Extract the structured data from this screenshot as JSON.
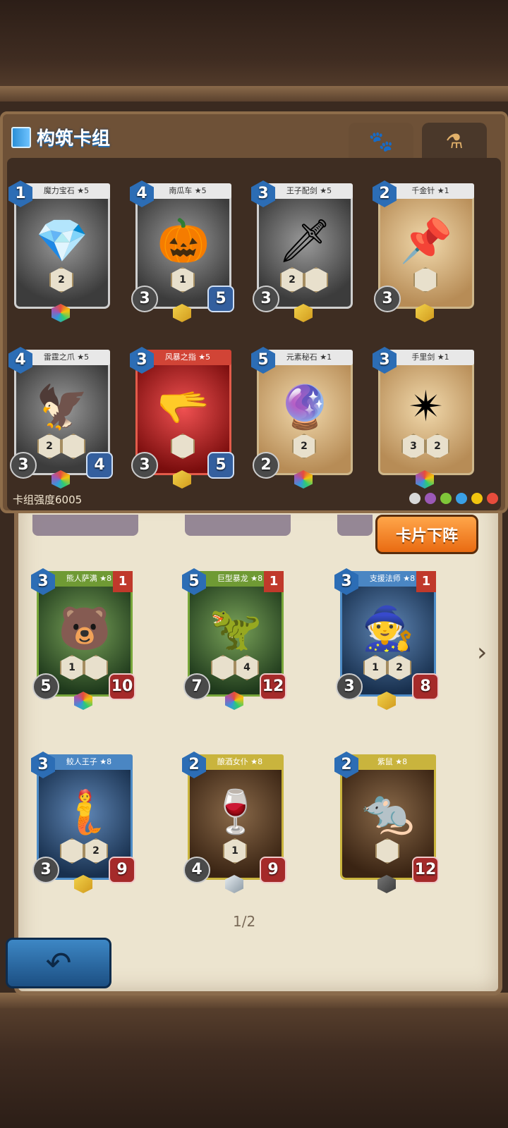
{
  "header": {
    "title": "构筑卡组"
  },
  "tabs": [
    {
      "name": "pets",
      "icon": "paw-icon"
    },
    {
      "name": "items",
      "icon": "potion-icon"
    }
  ],
  "deck": {
    "strength_label": "卡组强度6005",
    "cards": [
      {
        "name": "魔力宝石 ★5",
        "cost": "1",
        "attack": "",
        "health": "",
        "abilities": [
          "2"
        ],
        "gem": "rainbow",
        "frame": "silver",
        "art": "💎"
      },
      {
        "name": "南瓜车 ★5",
        "cost": "4",
        "attack": "3",
        "health": "5",
        "abilities": [
          "1"
        ],
        "gem": "gold",
        "frame": "silver",
        "art": "🎃"
      },
      {
        "name": "王子配剑 ★5",
        "cost": "3",
        "attack": "3",
        "health": "",
        "abilities": [
          "2",
          ""
        ],
        "gem": "gold",
        "frame": "silver",
        "art": "🗡"
      },
      {
        "name": "千金针 ★1",
        "cost": "2",
        "attack": "3",
        "health": "",
        "abilities": [
          ""
        ],
        "gem": "gold",
        "frame": "gold",
        "art": "📌"
      },
      {
        "name": "雷霆之爪 ★5",
        "cost": "4",
        "attack": "3",
        "health": "4",
        "abilities": [
          "2",
          ""
        ],
        "gem": "rainbow",
        "frame": "silver",
        "art": "🦅"
      },
      {
        "name": "风暴之指 ★5",
        "cost": "3",
        "attack": "3",
        "health": "5",
        "abilities": [
          ""
        ],
        "gem": "gold",
        "frame": "red",
        "art": "🫳"
      },
      {
        "name": "元素秘石 ★1",
        "cost": "5",
        "attack": "2",
        "health": "",
        "abilities": [
          "2"
        ],
        "gem": "rainbow",
        "frame": "gold",
        "art": "🔮"
      },
      {
        "name": "手里剑 ★1",
        "cost": "3",
        "attack": "",
        "health": "",
        "abilities": [
          "3",
          "2"
        ],
        "gem": "rainbow",
        "frame": "gold",
        "art": "✴"
      }
    ]
  },
  "elements": [
    {
      "name": "neutral",
      "color": "#d8d8d8"
    },
    {
      "name": "arcane",
      "color": "#9b59b6"
    },
    {
      "name": "nature",
      "color": "#7fc639"
    },
    {
      "name": "water",
      "color": "#3aa0e6"
    },
    {
      "name": "electric",
      "color": "#f1c40f"
    },
    {
      "name": "fire",
      "color": "#e74c3c"
    }
  ],
  "unequip_button": "卡片下阵",
  "collection": {
    "page": "1/2",
    "cards": [
      {
        "name": "熊人萨满 ★8",
        "cost": "3",
        "attack": "5",
        "health": "10",
        "level": "1",
        "abilities": [
          "1",
          ""
        ],
        "gem": "rainbow",
        "frame": "green",
        "art": "🐻"
      },
      {
        "name": "巨型暴龙 ★8",
        "cost": "5",
        "attack": "7",
        "health": "12",
        "level": "1",
        "abilities": [
          "",
          "4"
        ],
        "gem": "rainbow",
        "frame": "green",
        "art": "🦖"
      },
      {
        "name": "支援法师 ★8",
        "cost": "3",
        "attack": "3",
        "health": "8",
        "level": "1",
        "abilities": [
          "1",
          "2"
        ],
        "gem": "gold",
        "frame": "blue",
        "art": "🧙"
      },
      {
        "name": "鲛人王子 ★8",
        "cost": "3",
        "attack": "3",
        "health": "9",
        "level": "",
        "abilities": [
          "",
          "2"
        ],
        "gem": "gold",
        "frame": "blue",
        "art": "🧜"
      },
      {
        "name": "酿酒女仆 ★8",
        "cost": "2",
        "attack": "4",
        "health": "9",
        "level": "",
        "abilities": [
          "1"
        ],
        "gem": "silver",
        "frame": "yellow",
        "art": "🍷"
      },
      {
        "name": "紫鼠 ★8",
        "cost": "2",
        "attack": "",
        "health": "12",
        "level": "",
        "abilities": [
          ""
        ],
        "gem": "dark",
        "frame": "yellow",
        "art": "🐀"
      }
    ]
  }
}
